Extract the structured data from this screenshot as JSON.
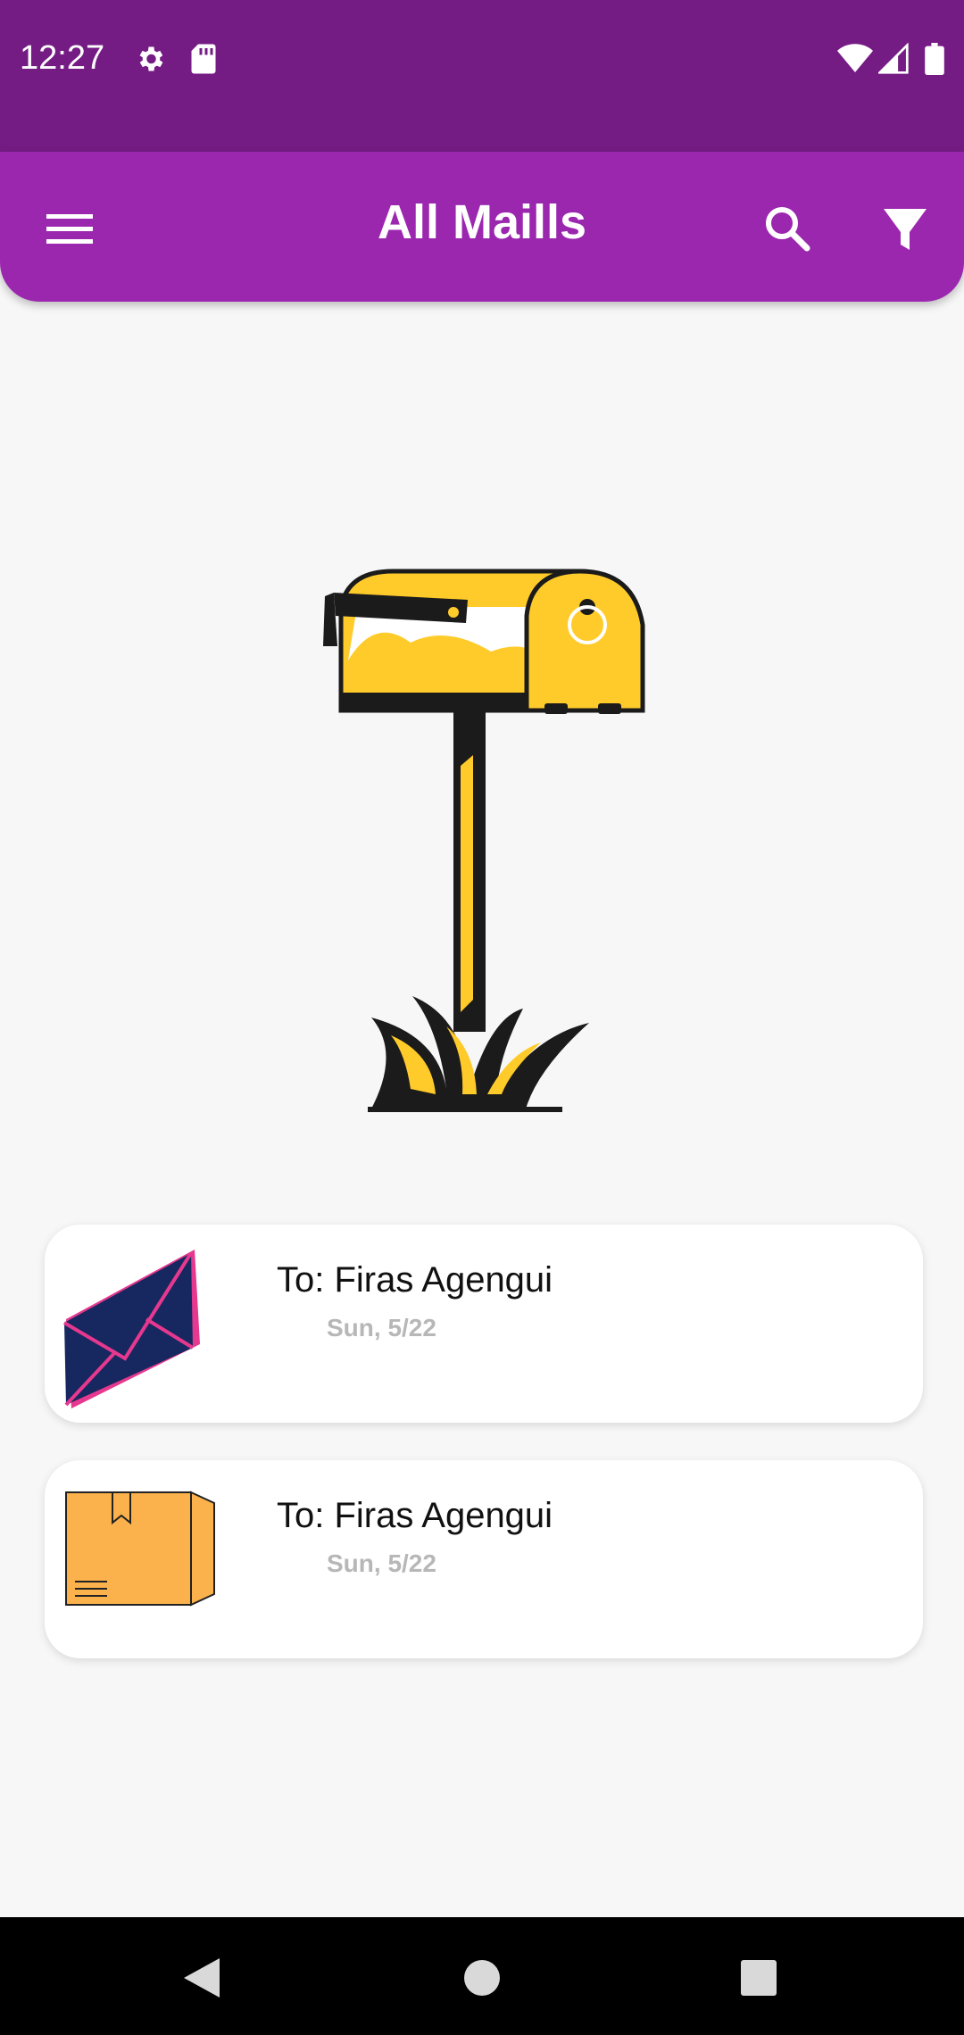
{
  "status_bar": {
    "time": "12:27",
    "left_icons": [
      "gear-icon",
      "sd-card-icon"
    ],
    "right_icons": [
      "wifi-icon",
      "signal-icon",
      "battery-icon"
    ]
  },
  "app_bar": {
    "title": "All Maills",
    "color": "#9b27af",
    "status_color": "#751c84",
    "menu_icon": "menu-icon",
    "search_icon": "search-icon",
    "filter_icon": "filter-icon"
  },
  "illustration": "mailbox-illustration",
  "mails": [
    {
      "icon": "envelope-icon",
      "to": "To: Firas Agengui",
      "date": "Sun, 5/22"
    },
    {
      "icon": "package-icon",
      "to": "To: Firas Agengui",
      "date": "Sun, 5/22"
    }
  ],
  "nav_bar": {
    "buttons": [
      "back-icon",
      "home-icon",
      "recents-icon"
    ]
  }
}
